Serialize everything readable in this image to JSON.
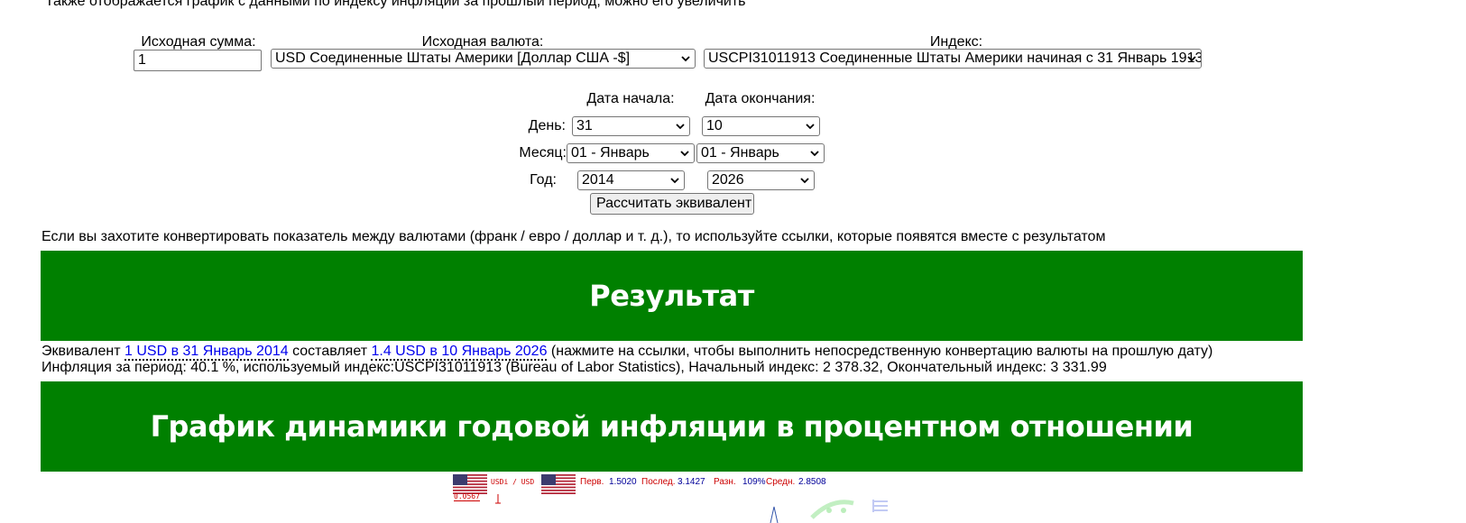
{
  "intro_text": "Также отображается график с данными по индексу инфляции за прошлый период; можно его увеличить",
  "form": {
    "amount_label": "Исходная сумма:",
    "amount_value": "1",
    "currency_label": "Исходная валюта:",
    "currency_selected": "USD Соединенные Штаты Америки [Доллар США -$]",
    "index_label": "Индекс:",
    "index_selected": "USCPI31011913 Соединенные Штаты Америки начиная с 31 Январь 1913",
    "start_label": "Дата начала:",
    "end_label": "Дата окончания:",
    "day_label": "День:",
    "month_label": "Месяц:",
    "year_label": "Год:",
    "start_day": "31",
    "end_day": "10",
    "start_month": "01 - Январь",
    "end_month": "01 - Январь",
    "start_year": "2014",
    "end_year": "2026",
    "calculate_button": "Рассчитать эквивалент"
  },
  "note_text": "Если вы захотите конвертировать показатель между валютами (франк / евро / доллар и т. д.), то используйте ссылки, которые появятся вместе с результатом",
  "result": {
    "heading": "Результат",
    "line1_prefix": "Эквивалент ",
    "line1_link_start": "1 USD в 31 Январь 2014",
    "line1_middle": " составляет ",
    "line1_link_end": "1.4 USD в 10 Январь 2026",
    "line1_suffix": " (нажмите на ссылки, чтобы выполнить непосредственную конвертацию валюты на прошлую дату)",
    "line2": "Инфляция за период: 40.1 %, используемый индекс:USCPI31011913 (Bureau of Labor Statistics), Начальный индекс: 2 378.32, Окончательный индекс: 3 331.99"
  },
  "chart_section": {
    "heading": "График динамики годовой инфляции в процентном отношении",
    "pair_label": "USDi / USD",
    "small_value": "0.0567",
    "stats": {
      "first_label": "Перв.",
      "first_value": "1.5020",
      "last_label": "Послед.",
      "last_value": "3.1427",
      "diff_label": "Разн.",
      "diff_value": "109%",
      "avg_label": "Средн.",
      "avg_value": "2.8508"
    },
    "colors": {
      "label_red": "#cc0000",
      "value_blue": "#000099",
      "banner_green": "#008000"
    }
  }
}
